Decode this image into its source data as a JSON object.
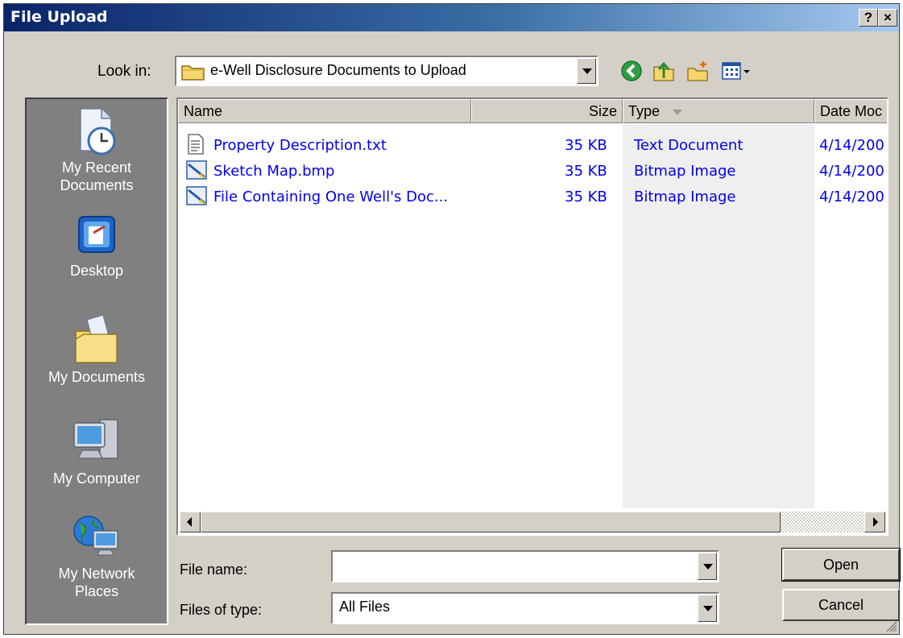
{
  "window": {
    "title": "File Upload",
    "help_label": "?",
    "close_label": "×"
  },
  "look_in": {
    "label": "Look in:",
    "value": "e-Well Disclosure Documents to Upload"
  },
  "toolbar": {
    "icons": [
      "back-icon",
      "up-folder-icon",
      "new-folder-icon",
      "views-menu-icon"
    ]
  },
  "places": [
    {
      "label_line1": "My Recent",
      "label_line2": "Documents"
    },
    {
      "label_line1": "Desktop",
      "label_line2": ""
    },
    {
      "label_line1": "My Documents",
      "label_line2": ""
    },
    {
      "label_line1": "My Computer",
      "label_line2": ""
    },
    {
      "label_line1": "My Network",
      "label_line2": "Places"
    }
  ],
  "file_list": {
    "columns": [
      "Name",
      "Size",
      "Type",
      "Date Moc"
    ],
    "sort_column": "Type",
    "rows": [
      {
        "name": "Property Description.txt",
        "size": "35 KB",
        "type": "Text Document",
        "date": "4/14/200",
        "icon": "text-file-icon"
      },
      {
        "name": "Sketch Map.bmp",
        "size": "35 KB",
        "type": "Bitmap Image",
        "date": "4/14/200",
        "icon": "bitmap-file-icon"
      },
      {
        "name": "File Containing One Well's Doc...",
        "size": "35 KB",
        "type": "Bitmap Image",
        "date": "4/14/200",
        "icon": "bitmap-file-icon"
      }
    ]
  },
  "file_name": {
    "label": "File name:",
    "value": ""
  },
  "file_type": {
    "label": "Files of type:",
    "value": "All Files"
  },
  "buttons": {
    "open": "Open",
    "cancel": "Cancel"
  }
}
